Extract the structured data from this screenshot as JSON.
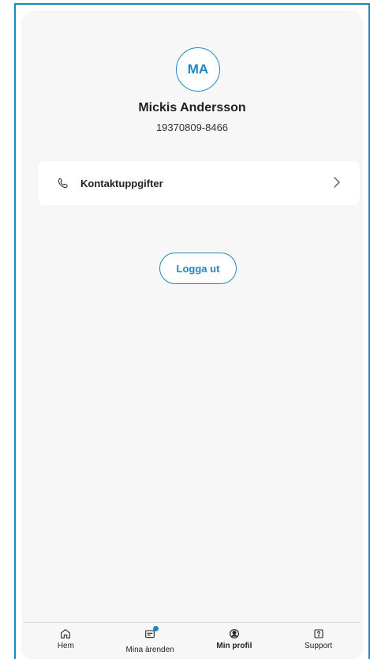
{
  "profile": {
    "initials": "MA",
    "name": "Mickis Andersson",
    "personal_number": "19370809-8466"
  },
  "menu": {
    "contact_label": "Kontaktuppgifter"
  },
  "actions": {
    "logout_label": "Logga ut"
  },
  "tabbar": {
    "items": [
      {
        "label": "Hem",
        "icon": "home-icon"
      },
      {
        "label": "Mina ärenden",
        "icon": "inbox-icon"
      },
      {
        "label": "Min profil",
        "icon": "profile-icon"
      },
      {
        "label": "Support",
        "icon": "support-icon"
      }
    ],
    "active": "Min profil"
  },
  "colors": {
    "accent": "#1b88c2",
    "background": "#f7f7f7",
    "card": "#ffffff"
  }
}
